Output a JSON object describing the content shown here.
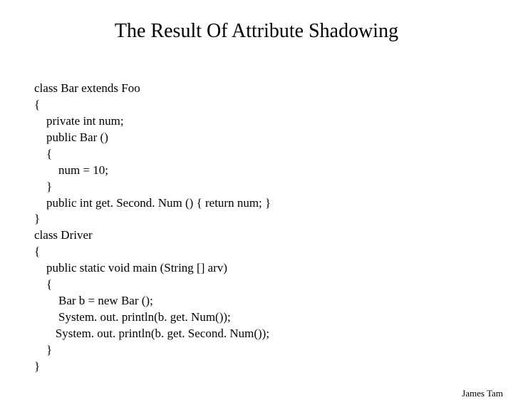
{
  "title": "The Result Of Attribute Shadowing",
  "code": {
    "l1": "class Bar extends Foo",
    "l2": "{",
    "l3": "    private int num;",
    "l4": "    public Bar ()",
    "l5": "    {",
    "l6": "        num = 10;",
    "l7": "    }",
    "l8": "    public int get. Second. Num () { return num; }",
    "l9": "}",
    "l10": "class Driver",
    "l11": "{",
    "l12": "    public static void main (String [] arv)",
    "l13": "    {",
    "l14": "        Bar b = new Bar ();",
    "l15": "        System. out. println(b. get. Num());",
    "l16": "       System. out. println(b. get. Second. Num());",
    "l17": "    }",
    "l18": "}"
  },
  "footer": "James Tam"
}
